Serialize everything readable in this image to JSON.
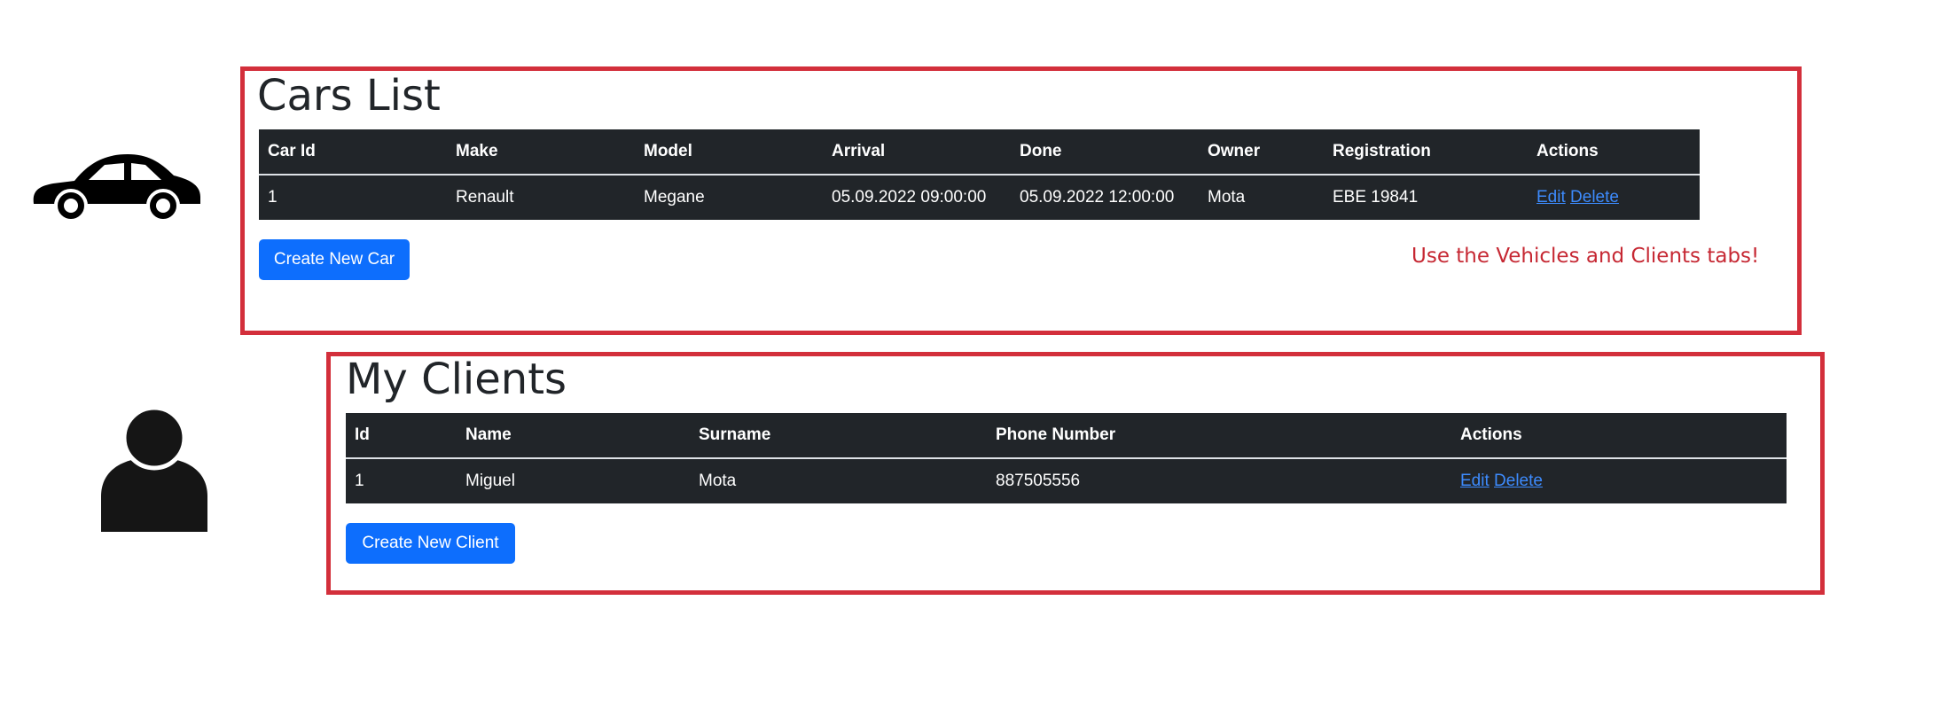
{
  "cars": {
    "title": "Cars List",
    "columns": [
      "Car Id",
      "Make",
      "Model",
      "Arrival",
      "Done",
      "Owner",
      "Registration",
      "Actions"
    ],
    "rows": [
      {
        "id": "1",
        "make": "Renault",
        "model": "Megane",
        "arrival": "05.09.2022 09:00:00",
        "done": "05.09.2022 12:00:00",
        "owner": "Mota",
        "registration": "EBE 19841"
      }
    ],
    "edit_label": "Edit",
    "delete_label": "Delete",
    "create_button": "Create New Car"
  },
  "hint": "Use the Vehicles and Clients tabs!",
  "clients": {
    "title": "My Clients",
    "columns": [
      "Id",
      "Name",
      "Surname",
      "Phone Number",
      "Actions"
    ],
    "rows": [
      {
        "id": "1",
        "name": "Miguel",
        "surname": "Mota",
        "phone": "887505556"
      }
    ],
    "edit_label": "Edit",
    "delete_label": "Delete",
    "create_button": "Create New Client"
  },
  "icons": [
    "car-icon",
    "person-icon"
  ],
  "colors": {
    "accent": "#0d6efd",
    "table_bg": "#212529",
    "frame": "#d32f3b",
    "hint": "#c62833",
    "link": "#3d8bfd"
  }
}
